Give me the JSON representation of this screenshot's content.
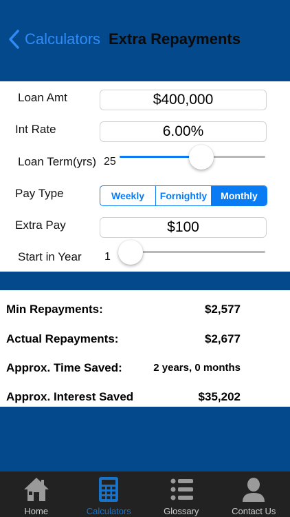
{
  "nav": {
    "back_label": "Calculators",
    "title": "Extra Repayments"
  },
  "form": {
    "loan_amt": {
      "label": "Loan Amt",
      "value": "$400,000"
    },
    "int_rate": {
      "label": "Int Rate",
      "value": "6.00%"
    },
    "loan_term": {
      "label": "Loan Term(yrs)",
      "value": "25",
      "fraction": 0.56
    },
    "pay_type": {
      "label": "Pay Type",
      "options": [
        "Weekly",
        "Fornightly",
        "Monthly"
      ],
      "selected": "Monthly"
    },
    "extra_pay": {
      "label": "Extra Pay",
      "value": "$100"
    },
    "start_year": {
      "label": "Start in Year",
      "value": "1",
      "fraction": 0.0
    }
  },
  "results": {
    "min_repayments": {
      "label": "Min Repayments:",
      "value": "$2,577"
    },
    "actual_repayments": {
      "label": "Actual Repayments:",
      "value": "$2,677"
    },
    "time_saved": {
      "label": "Approx. Time Saved:",
      "value": "2 years, 0 months"
    },
    "interest_saved": {
      "label": "Approx. Interest Saved",
      "value": "$35,202"
    }
  },
  "tabs": [
    {
      "label": "Home",
      "icon": "home-icon"
    },
    {
      "label": "Calculators",
      "icon": "calculator-icon",
      "active": true
    },
    {
      "label": "Glossary",
      "icon": "list-icon"
    },
    {
      "label": "Contact Us",
      "icon": "person-icon"
    }
  ],
  "colors": {
    "brand_blue": "#03498c",
    "accent": "#0a7cf3",
    "tab_active": "#1673c9"
  }
}
